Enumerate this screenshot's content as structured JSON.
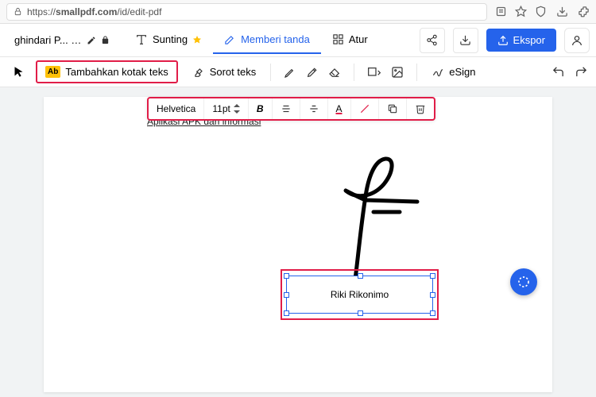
{
  "browser": {
    "url_prefix": "https://",
    "url_domain": "smallpdf.com",
    "url_path": "/id/edit-pdf"
  },
  "header": {
    "doc_name": "ghindari P... .pdf",
    "tabs": {
      "edit": "Sunting",
      "markup": "Memberi tanda",
      "organize": "Atur"
    },
    "export": "Ekspor"
  },
  "toolbar": {
    "add_textbox": "Tambahkan kotak teks",
    "highlight_text": "Sorot teks",
    "esign": "eSign"
  },
  "float_toolbar": {
    "font": "Helvetica",
    "size": "11pt"
  },
  "page": {
    "existing_text": "Aplikasi APK dari informasi",
    "textbox_value": "Riki Rikonimo"
  }
}
